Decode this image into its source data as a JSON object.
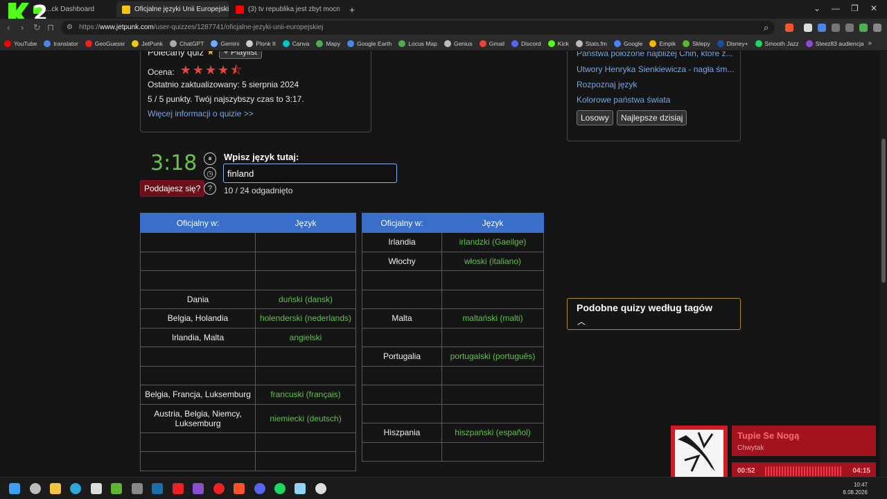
{
  "browser": {
    "tabs": [
      {
        "label": "...ck Dashboard",
        "active": false,
        "color": "#53fc18"
      },
      {
        "label": "Oficjalne języki Unii Europejskiej",
        "active": true,
        "color": "#f0c419"
      },
      {
        "label": "(3) tv republika jest zbyt mocna - You...",
        "active": false,
        "color": "#ff0000"
      }
    ],
    "new_tab": "+",
    "url_prefix": "https://",
    "url_host": "www.jetpunk.com",
    "url_path": "/user-quizzes/1287741/oficjalne-jezyki-unii-europejskiej",
    "bookmarks": [
      "YouTube",
      "translator",
      "GeoGuessr",
      "JetPunk",
      "ChatGPT",
      "Gemini",
      "Plonk It",
      "Canva",
      "Mapy",
      "Google Earth",
      "Locus Map",
      "Genius",
      "Gmail",
      "Discord",
      "Kick",
      "Stats.fm",
      "Google",
      "Empik",
      "Sklepy",
      "Disney+",
      "Smooth Jazz",
      "Steez83 audiencja"
    ],
    "logo_text": "2"
  },
  "info": {
    "recommended": "Polecany quiz",
    "playlist_btn": "+ Playlist",
    "rating_label": "Ocena:",
    "rating_value": 4.5,
    "rating_stars": "★★★★⯪",
    "updated": "Ostatnio zaktualizowany: 5 sierpnia 2024",
    "points": "5 / 5 punkty. Twój najszybszy czas to 3:17.",
    "more_link": "Więcej informacji o quizie >>"
  },
  "quiz": {
    "timer": "3:18",
    "giveup": "Poddajesz się?",
    "input_label": "Wpisz język tutaj:",
    "input_value": "finland",
    "progress": "10 / 24 odgadnięto",
    "col_country": "Oficjalny w:",
    "col_language": "Język",
    "table1": [
      {
        "country": "",
        "language": ""
      },
      {
        "country": "",
        "language": ""
      },
      {
        "country": "",
        "language": ""
      },
      {
        "country": "Dania",
        "language": "duński (dansk)"
      },
      {
        "country": "Belgia, Holandia",
        "language": "holenderski (nederlands)"
      },
      {
        "country": "Irlandia, Malta",
        "language": "angielski"
      },
      {
        "country": "",
        "language": ""
      },
      {
        "country": "",
        "language": ""
      },
      {
        "country": "Belgia, Francja, Luksemburg",
        "language": "francuski (français)"
      },
      {
        "country": "Austria, Belgia, Niemcy, Luksemburg",
        "language": "niemiecki (deutsch)"
      },
      {
        "country": "",
        "language": ""
      },
      {
        "country": "",
        "language": ""
      }
    ],
    "table2": [
      {
        "country": "Irlandia",
        "language": "irlandzki (Gaeilge)"
      },
      {
        "country": "Włochy",
        "language": "włoski (italiano)"
      },
      {
        "country": "",
        "language": ""
      },
      {
        "country": "",
        "language": ""
      },
      {
        "country": "Malta",
        "language": "maltański (malti)"
      },
      {
        "country": "",
        "language": ""
      },
      {
        "country": "Portugalia",
        "language": "portugalski (português)"
      },
      {
        "country": "",
        "language": ""
      },
      {
        "country": "",
        "language": ""
      },
      {
        "country": "",
        "language": ""
      },
      {
        "country": "Hiszpania",
        "language": "hiszpański (español)"
      },
      {
        "country": "",
        "language": ""
      }
    ]
  },
  "sidebar": {
    "links": [
      "Państwa położone najbliżej Chin, które z...",
      "Utwory Henryka Sienkiewicza - nagła śm...",
      "Rozpoznaj język",
      "Kolorowe państwa świata"
    ],
    "random_btn": "Losowy",
    "best_btn": "Najlepsze dzisiaj",
    "tags_title": "Podobne quizy według tagów"
  },
  "music": {
    "title": "Tupie Se Nogą",
    "artist": "Chwytak",
    "current": "00:52",
    "total": "04:15",
    "progress": 0.2
  },
  "taskbar": {
    "time": "10:47",
    "date": "8.08.2026"
  }
}
